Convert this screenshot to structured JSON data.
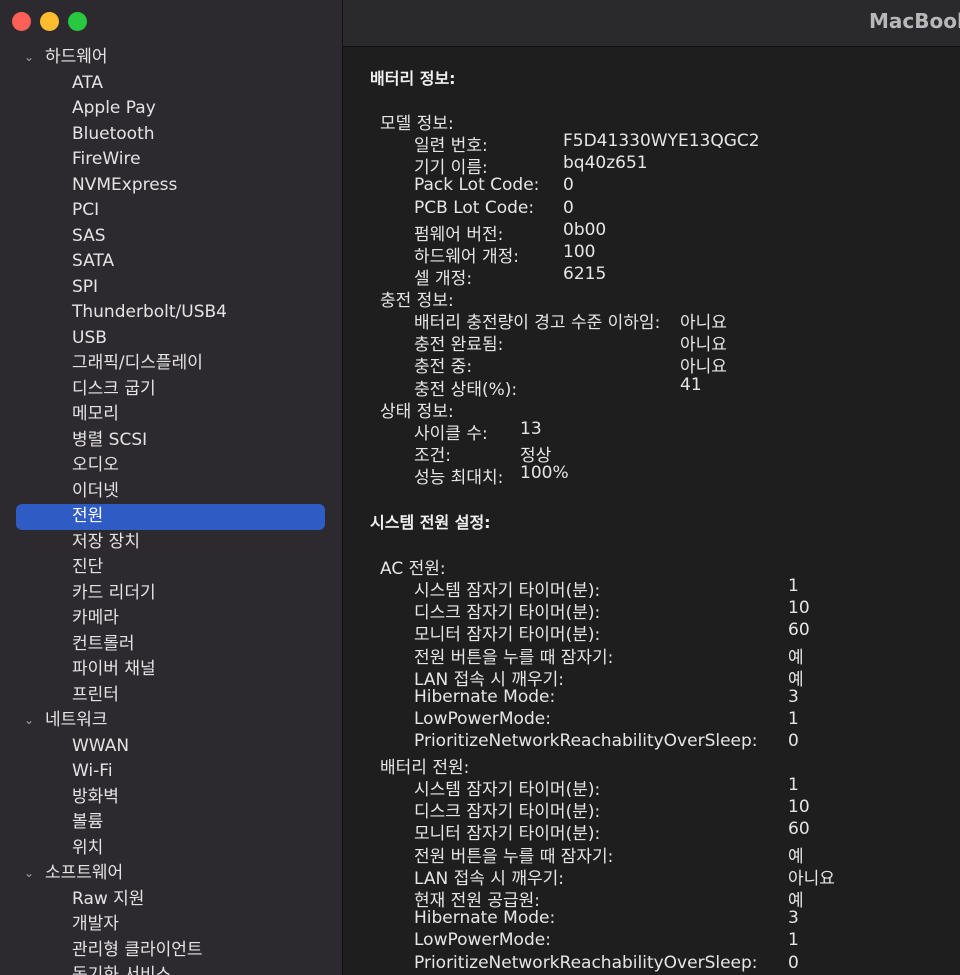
{
  "window": {
    "title": "MacBook"
  },
  "sidebar": {
    "hardware": {
      "label": "하드웨어",
      "items": [
        "ATA",
        "Apple Pay",
        "Bluetooth",
        "FireWire",
        "NVMExpress",
        "PCI",
        "SAS",
        "SATA",
        "SPI",
        "Thunderbolt/USB4",
        "USB",
        "그래픽/디스플레이",
        "디스크 굽기",
        "메모리",
        "병렬 SCSI",
        "오디오",
        "이더넷",
        "전원",
        "저장 장치",
        "진단",
        "카드 리더기",
        "카메라",
        "컨트롤러",
        "파이버 채널",
        "프린터"
      ]
    },
    "network": {
      "label": "네트워크",
      "items": [
        "WWAN",
        "Wi-Fi",
        "방화벽",
        "볼륨",
        "위치"
      ]
    },
    "software": {
      "label": "소프트웨어",
      "items": [
        "Raw 지원",
        "개발자",
        "관리형 클라이언트",
        "동기화 서비스"
      ]
    }
  },
  "battery": {
    "title": "배터리 정보:",
    "model": {
      "label": "모델 정보:",
      "rows": [
        {
          "k": "일련 번호:",
          "v": "F5D41330WYE13QGC2"
        },
        {
          "k": "기기 이름:",
          "v": "bq40z651"
        },
        {
          "k": "Pack Lot Code:",
          "v": "0"
        },
        {
          "k": "PCB Lot Code:",
          "v": "0"
        },
        {
          "k": "펌웨어 버전:",
          "v": "0b00"
        },
        {
          "k": "하드웨어 개정:",
          "v": "100"
        },
        {
          "k": "셀 개정:",
          "v": "6215"
        }
      ]
    },
    "charge": {
      "label": "충전 정보:",
      "rows": [
        {
          "k": "배터리 충전량이 경고 수준 이하임:",
          "v": "아니요"
        },
        {
          "k": "충전 완료됨:",
          "v": "아니요"
        },
        {
          "k": "충전 중:",
          "v": "아니요"
        },
        {
          "k": "충전 상태(%):",
          "v": "41"
        }
      ]
    },
    "health": {
      "label": "상태 정보:",
      "rows": [
        {
          "k": "사이클 수:",
          "v": "13"
        },
        {
          "k": "조건:",
          "v": "정상"
        },
        {
          "k": "성능 최대치:",
          "v": "100%"
        }
      ]
    }
  },
  "power": {
    "title": "시스템 전원 설정:",
    "ac": {
      "label": "AC 전원:",
      "rows": [
        {
          "k": "시스템 잠자기 타이머(분):",
          "v": "1"
        },
        {
          "k": "디스크 잠자기 타이머(분):",
          "v": "10"
        },
        {
          "k": "모니터 잠자기 타이머(분):",
          "v": "60"
        },
        {
          "k": "전원 버튼을 누를 때 잠자기:",
          "v": "예"
        },
        {
          "k": "LAN 접속 시 깨우기:",
          "v": "예"
        },
        {
          "k": "Hibernate Mode:",
          "v": "3"
        },
        {
          "k": "LowPowerMode:",
          "v": "1"
        },
        {
          "k": "PrioritizeNetworkReachabilityOverSleep:",
          "v": "0"
        }
      ]
    },
    "battery": {
      "label": "배터리 전원:",
      "rows": [
        {
          "k": "시스템 잠자기 타이머(분):",
          "v": "1"
        },
        {
          "k": "디스크 잠자기 타이머(분):",
          "v": "10"
        },
        {
          "k": "모니터 잠자기 타이머(분):",
          "v": "60"
        },
        {
          "k": "전원 버튼을 누를 때 잠자기:",
          "v": "예"
        },
        {
          "k": "LAN 접속 시 깨우기:",
          "v": "아니요"
        },
        {
          "k": "현재 전원 공급원:",
          "v": "예"
        },
        {
          "k": "Hibernate Mode:",
          "v": "3"
        },
        {
          "k": "LowPowerMode:",
          "v": "1"
        },
        {
          "k": "PrioritizeNetworkReachabilityOverSleep:",
          "v": "0"
        }
      ]
    }
  }
}
